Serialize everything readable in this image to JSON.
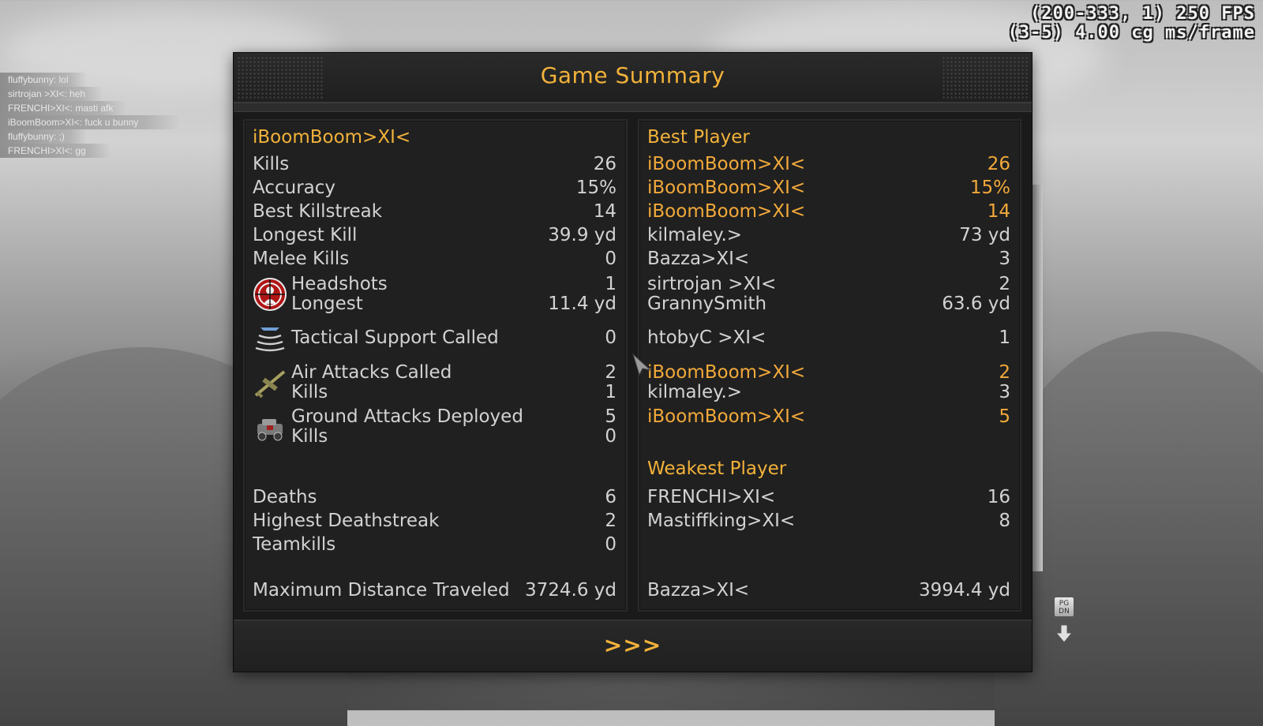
{
  "debug": {
    "line1": "(200-333, 1) 250 FPS",
    "line2": "(3-5) 4.00 cg ms/frame"
  },
  "chat": [
    "fluffybunny: lol",
    "sirtrojan >XI<: heh",
    "FRENCHI>XI<: masti afk",
    "iBoomBoom>XI<: fuck u bunny",
    "fluffybunny: ;)",
    "FRENCHI>XI<: gg"
  ],
  "title": "Game Summary",
  "player": {
    "name": "iBoomBoom>XI<",
    "kills_label": "Kills",
    "kills": "26",
    "accuracy_label": "Accuracy",
    "accuracy": "15%",
    "killstreak_label": "Best Killstreak",
    "killstreak": "14",
    "longest_kill_label": "Longest Kill",
    "longest_kill": "39.9 yd",
    "melee_label": "Melee Kills",
    "melee": "0",
    "headshots_label": "Headshots",
    "headshots": "1",
    "hs_longest_label": "Longest",
    "hs_longest": "11.4 yd",
    "tactical_label": "Tactical Support Called",
    "tactical": "0",
    "air_label": "Air Attacks Called",
    "air": "2",
    "air_kills_label": "Kills",
    "air_kills": "1",
    "ground_label": "Ground Attacks Deployed",
    "ground": "5",
    "ground_kills_label": "Kills",
    "ground_kills": "0",
    "deaths_label": "Deaths",
    "deaths": "6",
    "deathstreak_label": "Highest Deathstreak",
    "deathstreak": "2",
    "teamkills_label": "Teamkills",
    "teamkills": "0",
    "distance_label": "Maximum Distance Traveled",
    "distance": "3724.6 yd"
  },
  "best": {
    "title": "Best Player",
    "kills": {
      "name": "iBoomBoom>XI<",
      "value": "26"
    },
    "accuracy": {
      "name": "iBoomBoom>XI<",
      "value": "15%"
    },
    "killstreak": {
      "name": "iBoomBoom>XI<",
      "value": "14"
    },
    "longest_kill": {
      "name": "kilmaley.>",
      "value": "73 yd"
    },
    "melee": {
      "name": "Bazza>XI<",
      "value": "3"
    },
    "headshots": {
      "name": "sirtrojan >XI<",
      "value": "2"
    },
    "hs_longest": {
      "name": "GrannySmith",
      "value": "63.6 yd"
    },
    "tactical": {
      "name": "htobyC >XI<",
      "value": "1"
    },
    "air": {
      "name": "iBoomBoom>XI<",
      "value": "2"
    },
    "air_kills": {
      "name": "kilmaley.>",
      "value": "3"
    },
    "ground": {
      "name": "iBoomBoom>XI<",
      "value": "5"
    }
  },
  "weakest": {
    "title": "Weakest Player",
    "deaths": {
      "name": "FRENCHI>XI<",
      "value": "16"
    },
    "deathstreak": {
      "name": "Mastiffking>XI<",
      "value": "8"
    }
  },
  "distance_best": {
    "name": "Bazza>XI<",
    "value": "3994.4 yd"
  },
  "next_label": ">>>",
  "pgdn_label": "PG DN",
  "colors": {
    "accent": "#f2b23a",
    "highlight": "#f2a93a",
    "text": "#d2d2d2",
    "panel": "#1a1a1a"
  },
  "icons": [
    "headshot-icon",
    "tactical-support-icon",
    "air-attack-icon",
    "ground-attack-icon",
    "pgdn-key-icon",
    "down-arrow-icon",
    "mouse-cursor-icon"
  ]
}
